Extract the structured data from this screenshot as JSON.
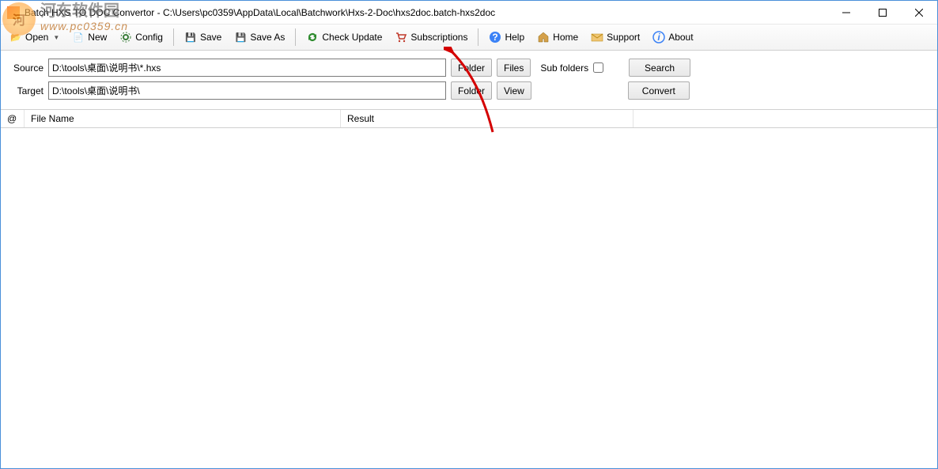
{
  "window": {
    "title": "Batch HXS TO DOC Convertor - C:\\Users\\pc0359\\AppData\\Local\\Batchwork\\Hxs-2-Doc\\hxs2doc.batch-hxs2doc"
  },
  "watermark": {
    "cn": "河东软件园",
    "url": "www.pc0359.cn"
  },
  "toolbar": {
    "open": "Open",
    "new": "New",
    "config": "Config",
    "save": "Save",
    "save_as": "Save As",
    "check_update": "Check Update",
    "subscriptions": "Subscriptions",
    "help": "Help",
    "home": "Home",
    "support": "Support",
    "about": "About"
  },
  "form": {
    "source_label": "Source",
    "source_value": "D:\\tools\\桌面\\说明书\\*.hxs",
    "target_label": "Target",
    "target_value": "D:\\tools\\桌面\\说明书\\",
    "folder_btn": "Folder",
    "files_btn": "Files",
    "view_btn": "View",
    "sub_folders": "Sub folders",
    "search_btn": "Search",
    "convert_btn": "Convert"
  },
  "columns": {
    "at": "@",
    "file_name": "File Name",
    "result": "Result"
  }
}
